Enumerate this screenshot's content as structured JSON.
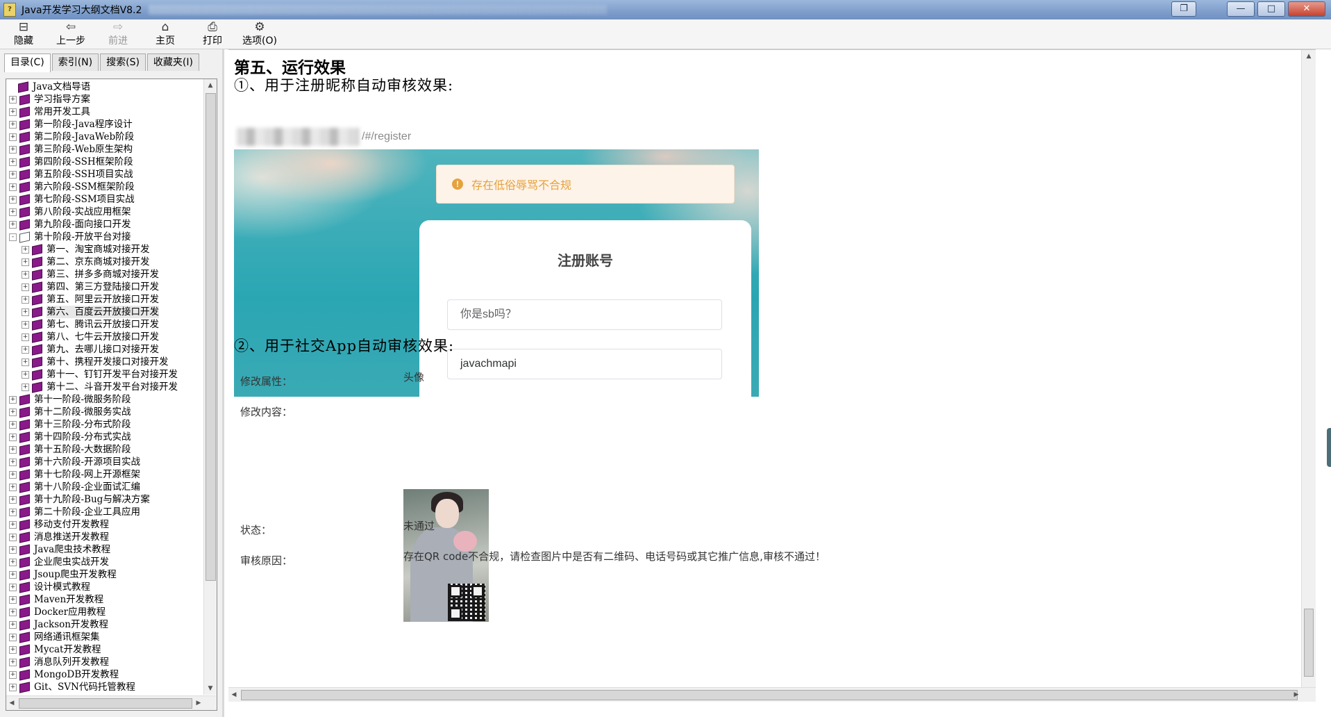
{
  "window": {
    "title": "Java开发学习大纲文档V8.2",
    "buttons": {
      "restore": "❐",
      "minimize": "—",
      "maximize": "□",
      "close": "✕"
    }
  },
  "toolbar": [
    {
      "label": "隐藏",
      "icon": "hide-icon",
      "glyph": "⊟",
      "disabled": false
    },
    {
      "label": "上一步",
      "icon": "back-icon",
      "glyph": "⇦",
      "disabled": false
    },
    {
      "label": "前进",
      "icon": "forward-icon",
      "glyph": "⇨",
      "disabled": true
    },
    {
      "label": "主页",
      "icon": "home-icon",
      "glyph": "⌂",
      "disabled": false
    },
    {
      "label": "打印",
      "icon": "print-icon",
      "glyph": "⎙",
      "disabled": false
    },
    {
      "label": "选项(O)",
      "icon": "options-icon",
      "glyph": "⚙",
      "disabled": false
    }
  ],
  "nav_tabs": [
    "目录(C)",
    "索引(N)",
    "搜索(S)",
    "收藏夹(I)"
  ],
  "tree": [
    {
      "label": "Java文档导语",
      "level": 0,
      "exp": ""
    },
    {
      "label": "学习指导方案",
      "level": 0,
      "exp": "+"
    },
    {
      "label": "常用开发工具",
      "level": 0,
      "exp": "+"
    },
    {
      "label": "第一阶段-Java程序设计",
      "level": 0,
      "exp": "+"
    },
    {
      "label": "第二阶段-JavaWeb阶段",
      "level": 0,
      "exp": "+"
    },
    {
      "label": "第三阶段-Web原生架构",
      "level": 0,
      "exp": "+"
    },
    {
      "label": "第四阶段-SSH框架阶段",
      "level": 0,
      "exp": "+"
    },
    {
      "label": "第五阶段-SSH项目实战",
      "level": 0,
      "exp": "+"
    },
    {
      "label": "第六阶段-SSM框架阶段",
      "level": 0,
      "exp": "+"
    },
    {
      "label": "第七阶段-SSM项目实战",
      "level": 0,
      "exp": "+"
    },
    {
      "label": "第八阶段-实战应用框架",
      "level": 0,
      "exp": "+"
    },
    {
      "label": "第九阶段-面向接口开发",
      "level": 0,
      "exp": "+"
    },
    {
      "label": "第十阶段-开放平台对接",
      "level": 0,
      "exp": "-",
      "open": true
    },
    {
      "label": "第一、淘宝商城对接开发",
      "level": 1,
      "exp": "+"
    },
    {
      "label": "第二、京东商城对接开发",
      "level": 1,
      "exp": "+"
    },
    {
      "label": "第三、拼多多商城对接开发",
      "level": 1,
      "exp": "+"
    },
    {
      "label": "第四、第三方登陆接口开发",
      "level": 1,
      "exp": "+"
    },
    {
      "label": "第五、阿里云开放接口开发",
      "level": 1,
      "exp": "+"
    },
    {
      "label": "第六、百度云开放接口开发",
      "level": 1,
      "exp": "+",
      "selected": true
    },
    {
      "label": "第七、腾讯云开放接口开发",
      "level": 1,
      "exp": "+"
    },
    {
      "label": "第八、七牛云开放接口开发",
      "level": 1,
      "exp": "+"
    },
    {
      "label": "第九、去哪儿接口对接开发",
      "level": 1,
      "exp": "+"
    },
    {
      "label": "第十、携程开发接口对接开发",
      "level": 1,
      "exp": "+"
    },
    {
      "label": "第十一、钉钉开发平台对接开发",
      "level": 1,
      "exp": "+"
    },
    {
      "label": "第十二、斗音开发平台对接开发",
      "level": 1,
      "exp": "+"
    },
    {
      "label": "第十一阶段-微服务阶段",
      "level": 0,
      "exp": "+"
    },
    {
      "label": "第十二阶段-微服务实战",
      "level": 0,
      "exp": "+"
    },
    {
      "label": "第十三阶段-分布式阶段",
      "level": 0,
      "exp": "+"
    },
    {
      "label": "第十四阶段-分布式实战",
      "level": 0,
      "exp": "+"
    },
    {
      "label": "第十五阶段-大数据阶段",
      "level": 0,
      "exp": "+"
    },
    {
      "label": "第十六阶段-开源项目实战",
      "level": 0,
      "exp": "+"
    },
    {
      "label": "第十七阶段-网上开源框架",
      "level": 0,
      "exp": "+"
    },
    {
      "label": "第十八阶段-企业面试汇编",
      "level": 0,
      "exp": "+"
    },
    {
      "label": "第十九阶段-Bug与解决方案",
      "level": 0,
      "exp": "+"
    },
    {
      "label": "第二十阶段-企业工具应用",
      "level": 0,
      "exp": "+"
    },
    {
      "label": "移动支付开发教程",
      "level": 0,
      "exp": "+"
    },
    {
      "label": "消息推送开发教程",
      "level": 0,
      "exp": "+"
    },
    {
      "label": "Java爬虫技术教程",
      "level": 0,
      "exp": "+"
    },
    {
      "label": "企业爬虫实战开发",
      "level": 0,
      "exp": "+"
    },
    {
      "label": "Jsoup爬虫开发教程",
      "level": 0,
      "exp": "+"
    },
    {
      "label": "设计模式教程",
      "level": 0,
      "exp": "+"
    },
    {
      "label": "Maven开发教程",
      "level": 0,
      "exp": "+"
    },
    {
      "label": "Docker应用教程",
      "level": 0,
      "exp": "+"
    },
    {
      "label": "Jackson开发教程",
      "level": 0,
      "exp": "+"
    },
    {
      "label": "网络通讯框架集",
      "level": 0,
      "exp": "+"
    },
    {
      "label": "Mycat开发教程",
      "level": 0,
      "exp": "+"
    },
    {
      "label": "消息队列开发教程",
      "level": 0,
      "exp": "+"
    },
    {
      "label": "MongoDB开发教程",
      "level": 0,
      "exp": "+"
    },
    {
      "label": "Git、SVN代码托管教程",
      "level": 0,
      "exp": "+"
    }
  ],
  "content": {
    "section_title": "第五、运行效果",
    "sub1": "①、用于注册昵称自动审核效果:",
    "shot": {
      "url_suffix": "/#/register",
      "alert_text": "存在低俗辱骂不合规",
      "card_title": "注册账号",
      "field1": "你是sb吗？",
      "field2": "javachmapi"
    },
    "sub2": "②、用于社交App自动审核效果:",
    "review": {
      "attr_label": "修改属性：",
      "attr_value": "头像",
      "content_label": "修改内容：",
      "status_label": "状态：",
      "status_value": "未通过",
      "reason_label": "审核原因：",
      "reason_value": "存在QR code不合规，请检查图片中是否有二维码、电话号码或其它推广信息,审核不通过！"
    }
  }
}
